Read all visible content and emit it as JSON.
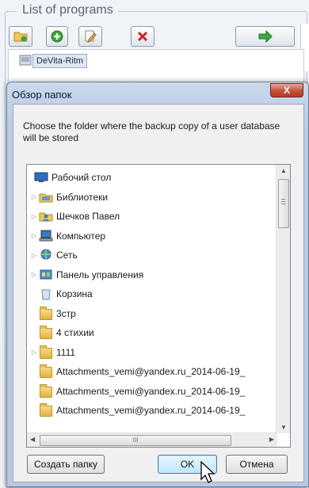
{
  "background_app": {
    "group_title": "List of programs",
    "program_item": "DeVita-Ritm",
    "toolbar_icons": [
      "open-folder-icon",
      "add-icon",
      "edit-icon",
      "delete-icon",
      "next-arrow-icon"
    ]
  },
  "dialog": {
    "title": "Обзор папок",
    "close_glyph": "X",
    "instruction": "Choose the folder where the backup copy of a user database will be stored",
    "tree_items": [
      {
        "label": "Рабочий стол",
        "icon": "desktop-icon",
        "indent": 0,
        "expander": false,
        "selected": true
      },
      {
        "label": "Библиотеки",
        "icon": "libraries-icon",
        "indent": 1,
        "expander": true
      },
      {
        "label": "Шечков Павел",
        "icon": "user-folder-icon",
        "indent": 1,
        "expander": true
      },
      {
        "label": "Компьютер",
        "icon": "computer-icon",
        "indent": 1,
        "expander": true
      },
      {
        "label": "Сеть",
        "icon": "network-icon",
        "indent": 1,
        "expander": true
      },
      {
        "label": "Панель управления",
        "icon": "control-panel-icon",
        "indent": 1,
        "expander": true
      },
      {
        "label": "Корзина",
        "icon": "recycle-bin-icon",
        "indent": 1,
        "expander": false
      },
      {
        "label": "3стр",
        "icon": "folder-icon",
        "indent": 1,
        "expander": false
      },
      {
        "label": "4 стихии",
        "icon": "folder-icon",
        "indent": 1,
        "expander": false
      },
      {
        "label": "1111",
        "icon": "folder-icon",
        "indent": 1,
        "expander": true
      },
      {
        "label": "Attachments_vemi@yandex.ru_2014-06-19_",
        "icon": "folder-icon",
        "indent": 1,
        "expander": false
      },
      {
        "label": "Attachments_vemi@yandex.ru_2014-06-19_",
        "icon": "folder-icon",
        "indent": 1,
        "expander": false
      },
      {
        "label": "Attachments_vemi@yandex.ru_2014-06-19_",
        "icon": "folder-icon",
        "indent": 1,
        "expander": false
      }
    ],
    "hscroll_grip": "III",
    "buttons": {
      "new_folder": "Создать папку",
      "ok": "OK",
      "cancel": "Отмена"
    }
  },
  "colors": {
    "dialog_frame": "#b8cbe4",
    "close_button": "#c7503a",
    "ok_button_border": "#3c7fb1",
    "selection": "#dfe7f4"
  }
}
